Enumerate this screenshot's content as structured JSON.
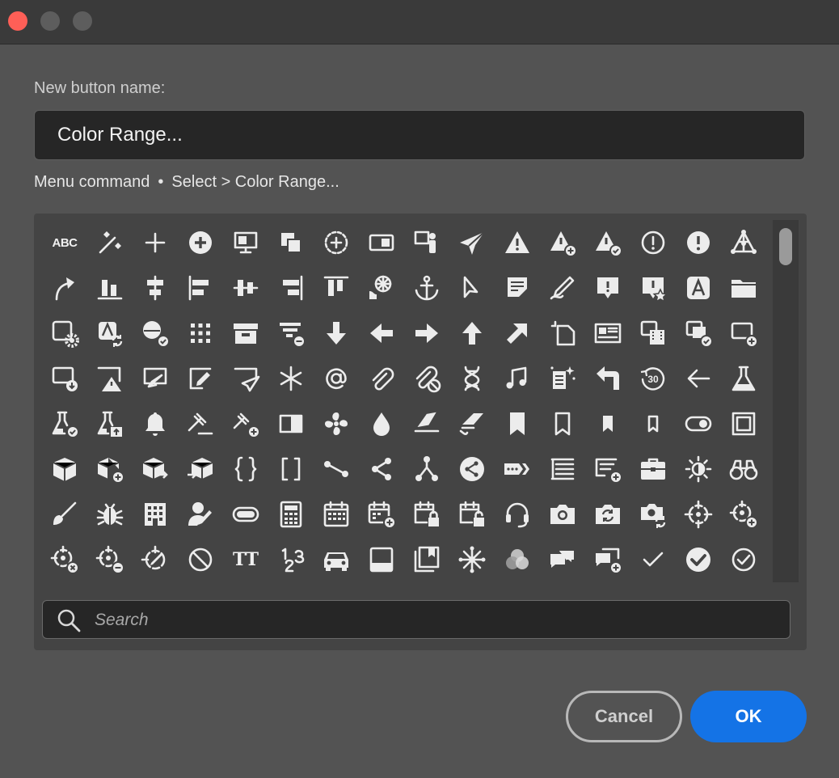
{
  "dialog": {
    "name_label": "New button name:",
    "name_value": "Color Range...",
    "menu_prefix": "Menu command",
    "menu_separator": "•",
    "menu_path": "Select > Color Range...",
    "search_placeholder": "Search",
    "cancel_label": "Cancel",
    "ok_label": "OK"
  },
  "icon_glyphs": {
    "abc": "ABC",
    "tt": "TT",
    "thirty": "30"
  },
  "icons": [
    "spell-check-icon",
    "magic-wand-icon",
    "plus-icon",
    "add-circle-icon",
    "monitor-icon",
    "layers-copy-icon",
    "add-circle-dashed-icon",
    "aspect-ratio-icon",
    "presenter-icon",
    "airplane-icon",
    "alert-icon",
    "alert-add-icon",
    "alert-check-icon",
    "alert-circle-outline-icon",
    "alert-circle-icon",
    "nodes-icon",
    "arrow-curve-icon",
    "align-bottom-icon",
    "align-center-icon",
    "align-left-icon",
    "align-middle-icon",
    "align-right-icon",
    "align-top-icon",
    "amusement-park-icon",
    "anchor-icon",
    "select-pointer-icon",
    "annotate-icon",
    "annotate-pen-icon",
    "announce-icon",
    "app-star-icon",
    "app-text-icon",
    "folder-icon",
    "app-settings-icon",
    "app-refresh-icon",
    "apps-check-icon",
    "grid-dots-icon",
    "archive-icon",
    "filter-remove-icon",
    "arrow-down-icon",
    "arrow-left-icon",
    "arrow-right-icon",
    "arrow-up-icon",
    "arrow-up-right-icon",
    "crop-icon",
    "article-icon",
    "asset-film-icon",
    "asset-check-icon",
    "add-to-icon",
    "download-icon",
    "alert-triangle-icon",
    "send-to-icon",
    "edit-frame-icon",
    "send-icon",
    "asterisk-icon",
    "at-sign-icon",
    "attach-icon",
    "attach-remove-icon",
    "dna-icon",
    "music-note-icon",
    "document-sparkle-icon",
    "back-icon",
    "rewind-30-icon",
    "back-arrow-icon",
    "beaker-icon",
    "beaker-check-icon",
    "beaker-share-icon",
    "bell-icon",
    "gavel-icon",
    "gavel-add-icon",
    "contrast-icon",
    "fan-icon",
    "drop-icon",
    "eraser-icon",
    "eraser-clip-icon",
    "bookmark-icon",
    "bookmark-outline-icon",
    "bookmark-small-icon",
    "bookmark-small-outline-icon",
    "toggle-icon",
    "frame-icon",
    "box-icon",
    "box-add-icon",
    "box-export-icon",
    "box-import-icon",
    "braces-icon",
    "brackets-icon",
    "branch-icon",
    "share-icon",
    "branch-circle-icon",
    "share-circle-icon",
    "breadcrumb-icon",
    "list-icon",
    "list-add-icon",
    "briefcase-icon",
    "brightness-icon",
    "binoculars-icon",
    "brush-icon",
    "bug-icon",
    "building-icon",
    "user-edit-icon",
    "button-icon",
    "calculator-icon",
    "calendar-icon",
    "calendar-add-icon",
    "calendar-lock-icon",
    "calendar-unlock-icon",
    "headset-icon",
    "camera-icon",
    "camera-refresh-icon",
    "camera-flip-icon",
    "target-icon",
    "target-add-icon",
    "target-remove-icon",
    "target-minus-icon",
    "target-edit-icon",
    "block-icon",
    "text-size-icon",
    "numbers-icon",
    "car-icon",
    "card-icon",
    "cards-icon",
    "hub-icon",
    "color-wheel-icon",
    "chat-icon",
    "chat-add-icon",
    "checkmark-icon",
    "check-circle-icon",
    "check-circle-outline-icon"
  ]
}
